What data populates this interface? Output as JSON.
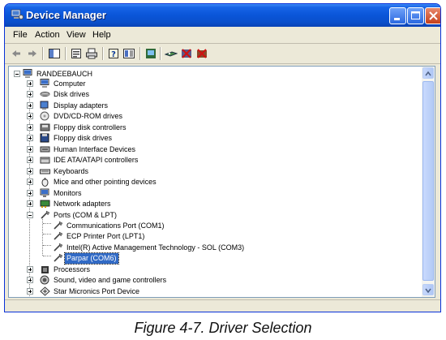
{
  "window": {
    "title": "Device Manager",
    "icon": "device-manager-icon"
  },
  "menu": [
    "File",
    "Action",
    "View",
    "Help"
  ],
  "toolbar": {
    "buttons": [
      "back-icon",
      "forward-icon",
      "show-hide-console-tree-icon",
      "properties-icon",
      "print-icon",
      "help-icon",
      "view-icon",
      "refresh-icon",
      "scan-hardware-changes-icon",
      "disable-device-icon",
      "uninstall-device-icon"
    ]
  },
  "tree": {
    "root": "RANDEEBAUCH",
    "items": [
      {
        "label": "Computer",
        "icon": "computer-icon"
      },
      {
        "label": "Disk drives",
        "icon": "disk-drive-icon"
      },
      {
        "label": "Display adapters",
        "icon": "display-adapter-icon"
      },
      {
        "label": "DVD/CD-ROM drives",
        "icon": "cdrom-icon"
      },
      {
        "label": "Floppy disk controllers",
        "icon": "floppy-controller-icon"
      },
      {
        "label": "Floppy disk drives",
        "icon": "floppy-drive-icon"
      },
      {
        "label": "Human Interface Devices",
        "icon": "hid-icon"
      },
      {
        "label": "IDE ATA/ATAPI controllers",
        "icon": "ide-controller-icon"
      },
      {
        "label": "Keyboards",
        "icon": "keyboard-icon"
      },
      {
        "label": "Mice and other pointing devices",
        "icon": "mouse-icon"
      },
      {
        "label": "Monitors",
        "icon": "monitor-icon"
      },
      {
        "label": "Network adapters",
        "icon": "network-adapter-icon"
      },
      {
        "label": "Ports (COM & LPT)",
        "icon": "port-icon"
      },
      {
        "label": "Communications Port (COM1)",
        "icon": "port-icon"
      },
      {
        "label": "ECP Printer Port (LPT1)",
        "icon": "port-icon"
      },
      {
        "label": "Intel(R) Active Management Technology - SOL (COM3)",
        "icon": "port-icon"
      },
      {
        "label": "Parpar (COM6)",
        "icon": "port-icon"
      },
      {
        "label": "Processors",
        "icon": "processor-icon"
      },
      {
        "label": "Sound, video and game controllers",
        "icon": "sound-icon"
      },
      {
        "label": "Star Micronics Port Device",
        "icon": "star-port-icon"
      }
    ]
  },
  "caption": "Figure 4-7. Driver Selection"
}
